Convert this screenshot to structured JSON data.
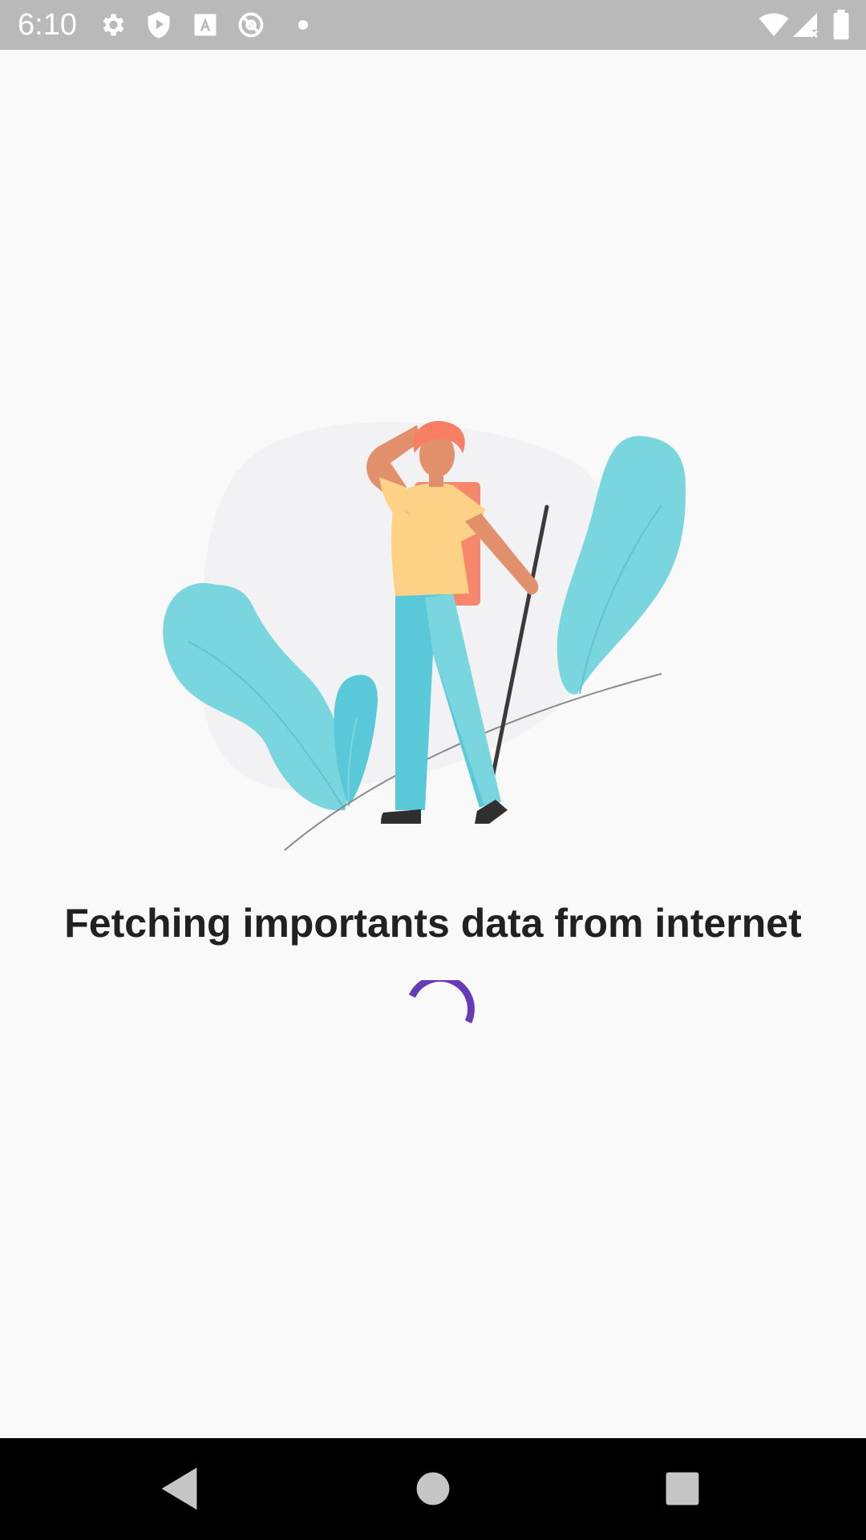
{
  "status_bar": {
    "time": "6:10",
    "left_icons": [
      "gear-icon",
      "shield-play-icon",
      "text-a-icon",
      "at-sign-icon",
      "notification-dot-icon"
    ],
    "right_icons": [
      "wifi-icon",
      "signal-icon",
      "battery-icon"
    ]
  },
  "main": {
    "title": "Fetching importants data from internet",
    "illustration": "hiker-illustration",
    "spinner_color": "#673ab7"
  },
  "nav_bar": {
    "buttons": [
      "back-icon",
      "home-icon",
      "recents-icon"
    ]
  },
  "colors": {
    "status_bar_bg": "#b9b9b9",
    "background": "#f9f9fa",
    "leaf": "#79d6df",
    "pants": "#59c9d9",
    "shirt": "#fdd287",
    "skin": "#e28f6c",
    "hair": "#f77e62",
    "nav_bar_bg": "#000000"
  }
}
